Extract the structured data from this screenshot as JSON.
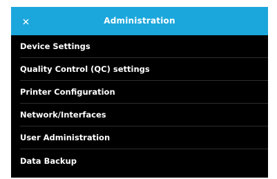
{
  "header": {
    "title": "Administration",
    "close_icon": "close-icon"
  },
  "colors": {
    "header_bg": "#1ba7dc",
    "panel_bg": "#000000",
    "text": "#ffffff"
  },
  "menu": {
    "items": [
      {
        "label": "Device Settings"
      },
      {
        "label": "Quality Control (QC) settings"
      },
      {
        "label": "Printer Configuration"
      },
      {
        "label": "Network/Interfaces"
      },
      {
        "label": "User Administration"
      },
      {
        "label": "Data Backup"
      }
    ]
  }
}
